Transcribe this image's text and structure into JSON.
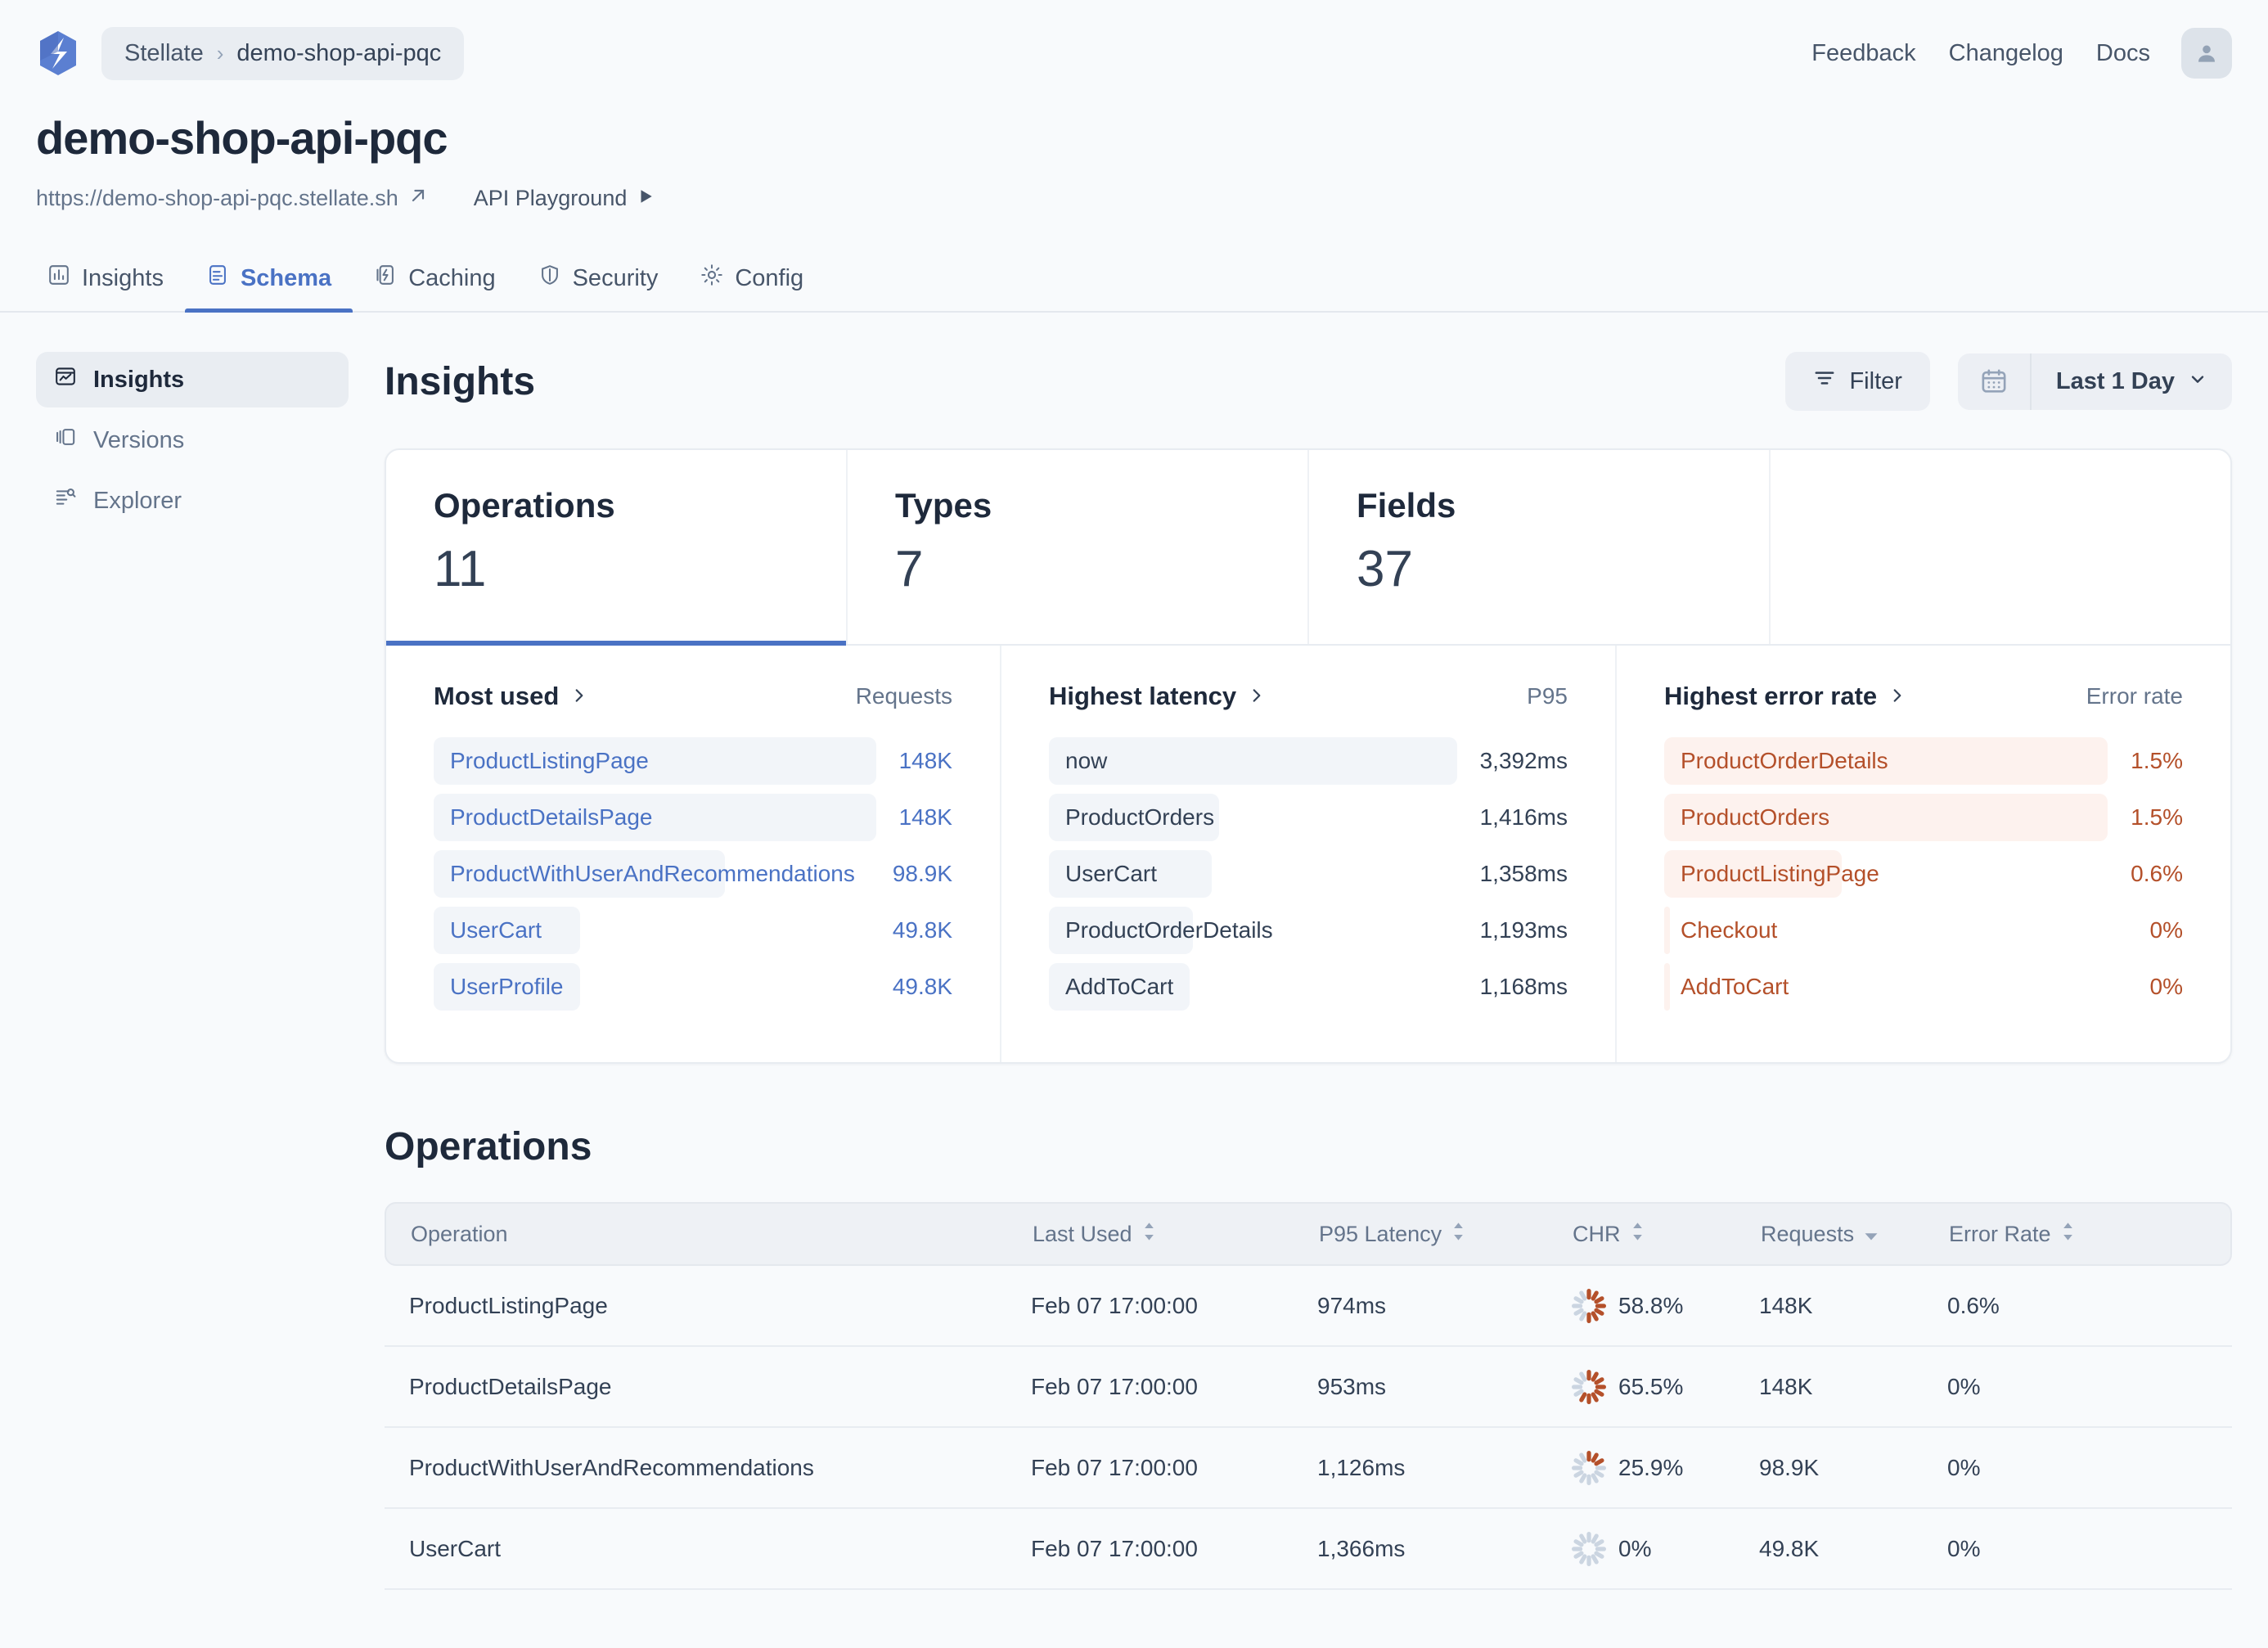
{
  "colors": {
    "accent": "#4a72c4",
    "error": "#b4502a",
    "error_bg": "#fdf2ee",
    "bar_bg": "#f2f5f9",
    "page_bg": "#f8fafc"
  },
  "topbar": {
    "logo_name": "stellate-logo-icon",
    "breadcrumb": {
      "org": "Stellate",
      "separator": "›",
      "service": "demo-shop-api-pqc"
    },
    "nav": [
      {
        "label": "Feedback",
        "name": "topnav-feedback"
      },
      {
        "label": "Changelog",
        "name": "topnav-changelog"
      },
      {
        "label": "Docs",
        "name": "topnav-docs"
      }
    ],
    "avatar_icon": "user-avatar-icon"
  },
  "pagehead": {
    "title": "demo-shop-api-pqc",
    "endpoint_url": "https://demo-shop-api-pqc.stellate.sh",
    "endpoint_icon": "external-link-icon",
    "playground_label": "API Playground",
    "playground_icon": "play-triangle-icon"
  },
  "tabs": [
    {
      "label": "Insights",
      "icon": "bar-chart-icon",
      "active": false
    },
    {
      "label": "Schema",
      "icon": "graphql-document-icon",
      "active": true
    },
    {
      "label": "Caching",
      "icon": "caching-layers-icon",
      "active": false
    },
    {
      "label": "Security",
      "icon": "shield-icon",
      "active": false
    },
    {
      "label": "Config",
      "icon": "gear-icon",
      "active": false
    }
  ],
  "sidebar": {
    "items": [
      {
        "label": "Insights",
        "icon": "insights-window-icon",
        "active": true
      },
      {
        "label": "Versions",
        "icon": "versions-stack-icon",
        "active": false
      },
      {
        "label": "Explorer",
        "icon": "explorer-search-list-icon",
        "active": false
      }
    ]
  },
  "main": {
    "title": "Insights",
    "filter_label": "Filter",
    "filter_icon": "filter-lines-icon",
    "calendar_icon": "calendar-icon",
    "daterange_label": "Last 1 Day",
    "daterange_caret": "chevron-down-icon"
  },
  "stats": [
    {
      "label": "Operations",
      "value": "11",
      "active": true
    },
    {
      "label": "Types",
      "value": "7",
      "active": false
    },
    {
      "label": "Fields",
      "value": "37",
      "active": false
    },
    {
      "label": "",
      "value": "",
      "active": false
    }
  ],
  "lists": [
    {
      "name": "most-used",
      "title": "Most used",
      "chevron": "chevron-right-icon",
      "metric_label": "Requests",
      "style": "blue",
      "rows": [
        {
          "label": "ProductListingPage",
          "value": "148K",
          "pct": 100
        },
        {
          "label": "ProductDetailsPage",
          "value": "148K",
          "pct": 100
        },
        {
          "label": "ProductWithUserAndRecommendations",
          "value": "98.9K",
          "pct": 66.8
        },
        {
          "label": "UserCart",
          "value": "49.8K",
          "pct": 33.6
        },
        {
          "label": "UserProfile",
          "value": "49.8K",
          "pct": 33.6
        }
      ]
    },
    {
      "name": "highest-latency",
      "title": "Highest latency",
      "chevron": "chevron-right-icon",
      "metric_label": "P95",
      "style": "dark",
      "rows": [
        {
          "label": "now",
          "value": "3,392ms",
          "pct": 100
        },
        {
          "label": "ProductOrders",
          "value": "1,416ms",
          "pct": 41.7
        },
        {
          "label": "UserCart",
          "value": "1,358ms",
          "pct": 40.0
        },
        {
          "label": "ProductOrderDetails",
          "value": "1,193ms",
          "pct": 35.2
        },
        {
          "label": "AddToCart",
          "value": "1,168ms",
          "pct": 34.4
        }
      ]
    },
    {
      "name": "highest-error-rate",
      "title": "Highest error rate",
      "chevron": "chevron-right-icon",
      "metric_label": "Error rate",
      "style": "red",
      "rows": [
        {
          "label": "ProductOrderDetails",
          "value": "1.5%",
          "pct": 100
        },
        {
          "label": "ProductOrders",
          "value": "1.5%",
          "pct": 100
        },
        {
          "label": "ProductListingPage",
          "value": "0.6%",
          "pct": 40
        },
        {
          "label": "Checkout",
          "value": "0%",
          "pct": 1.2
        },
        {
          "label": "AddToCart",
          "value": "0%",
          "pct": 1.2
        }
      ]
    }
  ],
  "operations": {
    "title": "Operations",
    "columns": [
      {
        "label": "Operation",
        "sort": "none",
        "key": "operation"
      },
      {
        "label": "Last Used",
        "sort": "both",
        "key": "last_used"
      },
      {
        "label": "P95 Latency",
        "sort": "both",
        "key": "p95"
      },
      {
        "label": "CHR",
        "sort": "both",
        "key": "chr"
      },
      {
        "label": "Requests",
        "sort": "desc",
        "key": "requests"
      },
      {
        "label": "Error Rate",
        "sort": "both",
        "key": "error_rate"
      }
    ],
    "rows": [
      {
        "operation": "ProductListingPage",
        "last_used": "Feb 07 17:00:00",
        "p95": "974ms",
        "chr": "58.8%",
        "chr_pct": 58.8,
        "requests": "148K",
        "error_rate": "0.6%"
      },
      {
        "operation": "ProductDetailsPage",
        "last_used": "Feb 07 17:00:00",
        "p95": "953ms",
        "chr": "65.5%",
        "chr_pct": 65.5,
        "requests": "148K",
        "error_rate": "0%"
      },
      {
        "operation": "ProductWithUserAndRecommendations",
        "last_used": "Feb 07 17:00:00",
        "p95": "1,126ms",
        "chr": "25.9%",
        "chr_pct": 25.9,
        "requests": "98.9K",
        "error_rate": "0%"
      },
      {
        "operation": "UserCart",
        "last_used": "Feb 07 17:00:00",
        "p95": "1,366ms",
        "chr": "0%",
        "chr_pct": 0,
        "requests": "49.8K",
        "error_rate": "0%"
      }
    ]
  }
}
